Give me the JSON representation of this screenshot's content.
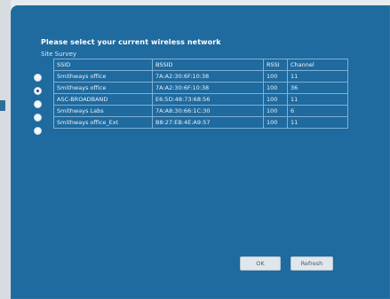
{
  "dialog": {
    "prompt": "Please select your current wireless network",
    "survey_label": "Site Survey"
  },
  "table": {
    "headers": [
      "SSID",
      "BSSID",
      "RSSI",
      "Channel"
    ],
    "rows": [
      {
        "ssid": "Smithways office",
        "bssid": "7A:A2:30:6F:10:38",
        "rssi": "100",
        "channel": "11",
        "selected": false
      },
      {
        "ssid": "Smithways office",
        "bssid": "7A:A2:30:6F:10:38",
        "rssi": "100",
        "channel": "36",
        "selected": true
      },
      {
        "ssid": "ASC-BROADBAND",
        "bssid": "E6:5D:48:73:68:56",
        "rssi": "100",
        "channel": "11",
        "selected": false
      },
      {
        "ssid": "Smithways Labs",
        "bssid": "7A:A8:30:66:1C:30",
        "rssi": "100",
        "channel": "6",
        "selected": false
      },
      {
        "ssid": "Smithways office_Ext",
        "bssid": "B8:27:EB:4E:A9:57",
        "rssi": "100",
        "channel": "11",
        "selected": false
      }
    ]
  },
  "buttons": {
    "ok": "OK",
    "refresh": "Refresh"
  },
  "colors": {
    "dialog_bg": "#1f6a9e",
    "grid_line": "#7fb0d6",
    "button_bg": "#dfe6ec"
  }
}
